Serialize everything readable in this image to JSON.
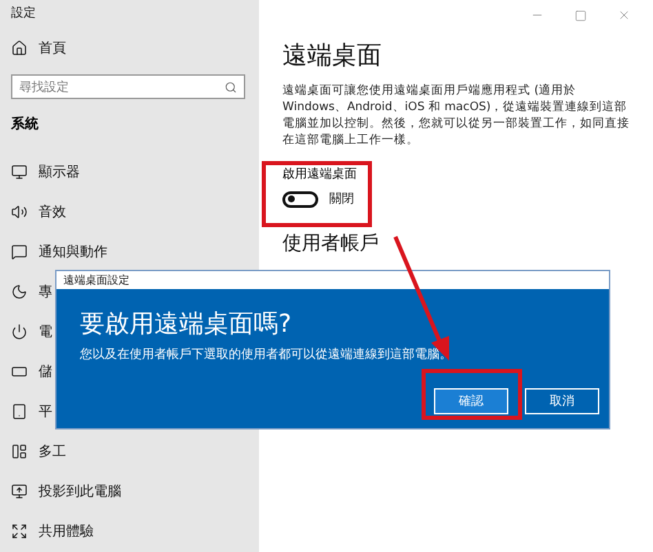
{
  "window": {
    "title": "設定"
  },
  "sidebar": {
    "home": {
      "label": "首頁"
    },
    "search": {
      "placeholder": "尋找設定"
    },
    "section": "系統",
    "items": [
      {
        "label": "顯示器"
      },
      {
        "label": "音效"
      },
      {
        "label": "通知與動作"
      },
      {
        "label": "專"
      },
      {
        "label": "電"
      },
      {
        "label": "儲"
      },
      {
        "label": "平"
      },
      {
        "label": "多工"
      },
      {
        "label": "投影到此電腦"
      },
      {
        "label": "共用體驗"
      }
    ]
  },
  "content": {
    "title": "遠端桌面",
    "description": "遠端桌面可讓您使用遠端桌面用戶端應用程式 (適用於 Windows、Android、iOS 和 macOS)，從遠端裝置連線到這部電腦並加以控制。然後，您就可以從另一部裝置工作，如同直接在這部電腦上工作一樣。",
    "toggle": {
      "label": "啟用遠端桌面",
      "on": false,
      "state_text": "關閉"
    },
    "section": "使用者帳戶"
  },
  "dialog": {
    "title": "遠端桌面設定",
    "heading": "要啟用遠端桌面嗎?",
    "message": "您以及在使用者帳戶下選取的使用者都可以從遠端連線到這部電腦。",
    "buttons": [
      {
        "label": "確認",
        "primary": true
      },
      {
        "label": "取消",
        "primary": false
      }
    ]
  }
}
